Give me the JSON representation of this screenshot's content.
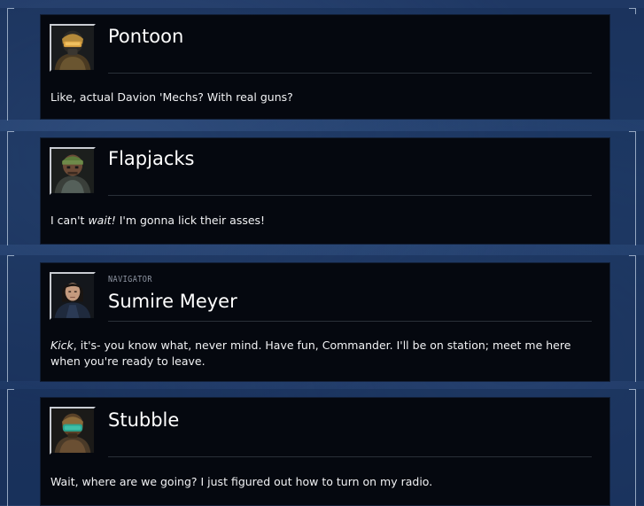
{
  "dialogue": [
    {
      "speaker": "Pontoon",
      "role": "",
      "portrait_icon": "pilot-portrait-icon",
      "accent": "#c8a04a",
      "text": [
        {
          "t": "Like, actual Davion 'Mechs? With real guns?",
          "i": false
        }
      ]
    },
    {
      "speaker": "Flapjacks",
      "role": "",
      "portrait_icon": "pilot-portrait-icon",
      "accent": "#6e8a4a",
      "text": [
        {
          "t": "I can't ",
          "i": false
        },
        {
          "t": "wait!",
          "i": true
        },
        {
          "t": " I'm gonna lick their asses!",
          "i": false
        }
      ]
    },
    {
      "speaker": "Sumire Meyer",
      "role": "NAVIGATOR",
      "portrait_icon": "navigator-portrait-icon",
      "accent": "#2b3a55",
      "text": [
        {
          "t": "Kick",
          "i": true
        },
        {
          "t": ", it's- you know what, never mind. Have fun, Commander. I'll be on station; meet me here when you're ready to leave.",
          "i": false
        }
      ]
    },
    {
      "speaker": "Stubble",
      "role": "",
      "portrait_icon": "pilot-portrait-icon",
      "accent": "#3fbfa8",
      "text": [
        {
          "t": "Wait, where are we going? I just figured out how to turn on my radio.",
          "i": false
        }
      ]
    }
  ]
}
